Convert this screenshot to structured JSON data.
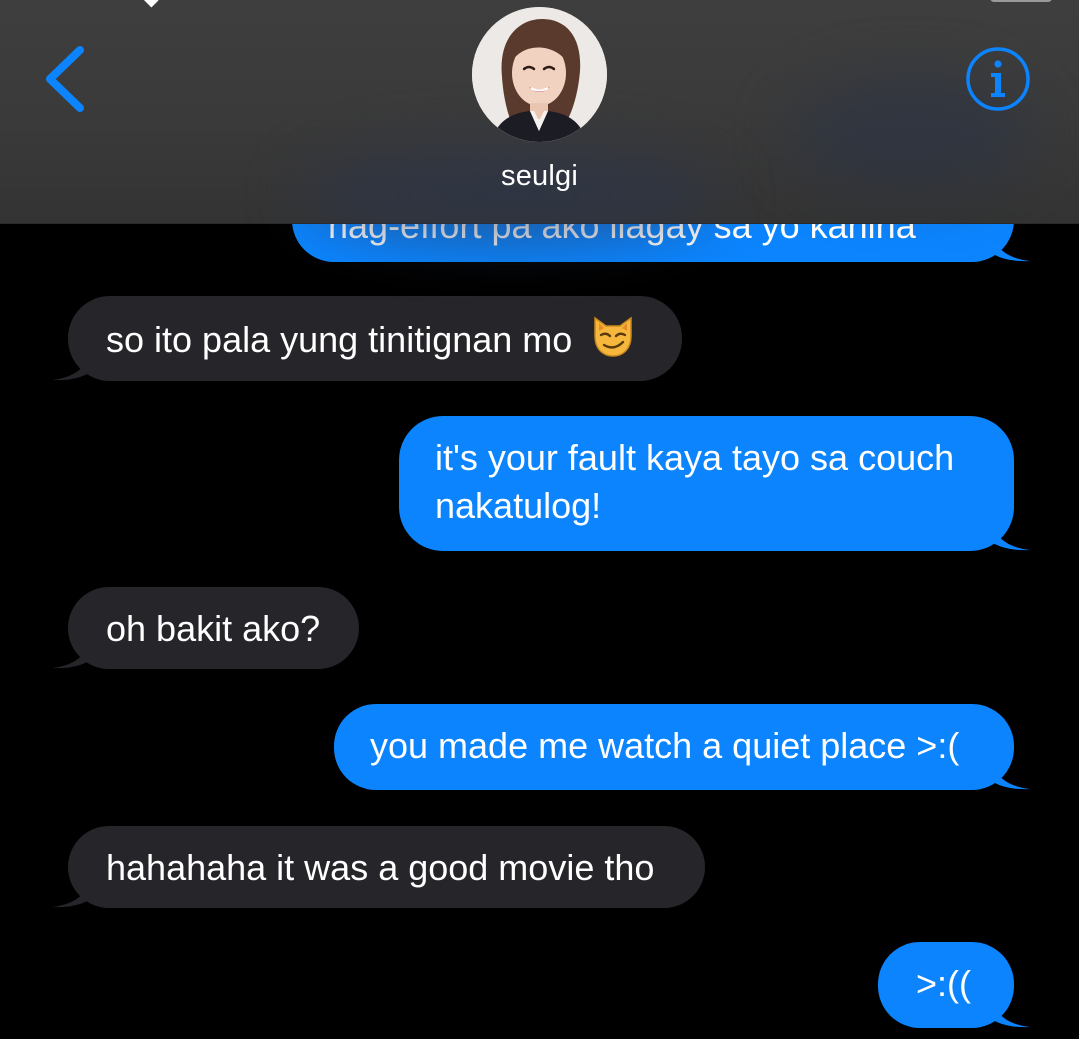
{
  "contact": {
    "name": "seulgi"
  },
  "icons": {
    "back": "chevron-left-icon",
    "info": "info-icon"
  },
  "colors": {
    "accent": "#0b84fe",
    "incoming_bubble": "#26252a",
    "background": "#000000"
  },
  "messages": [
    {
      "direction": "outgoing",
      "text": "nag-effort pa ako ilagay sa yo kanina"
    },
    {
      "direction": "incoming",
      "text": "so ito pala yung tinitignan mo",
      "emoji": "smirking-cat-face"
    },
    {
      "direction": "outgoing",
      "text": "it's your fault kaya tayo sa couch nakatulog!"
    },
    {
      "direction": "incoming",
      "text": "oh bakit ako?"
    },
    {
      "direction": "outgoing",
      "text": "you made me watch a quiet place >:("
    },
    {
      "direction": "incoming",
      "text": "hahahaha it was a good movie tho"
    },
    {
      "direction": "outgoing",
      "text": ">:(("
    }
  ]
}
